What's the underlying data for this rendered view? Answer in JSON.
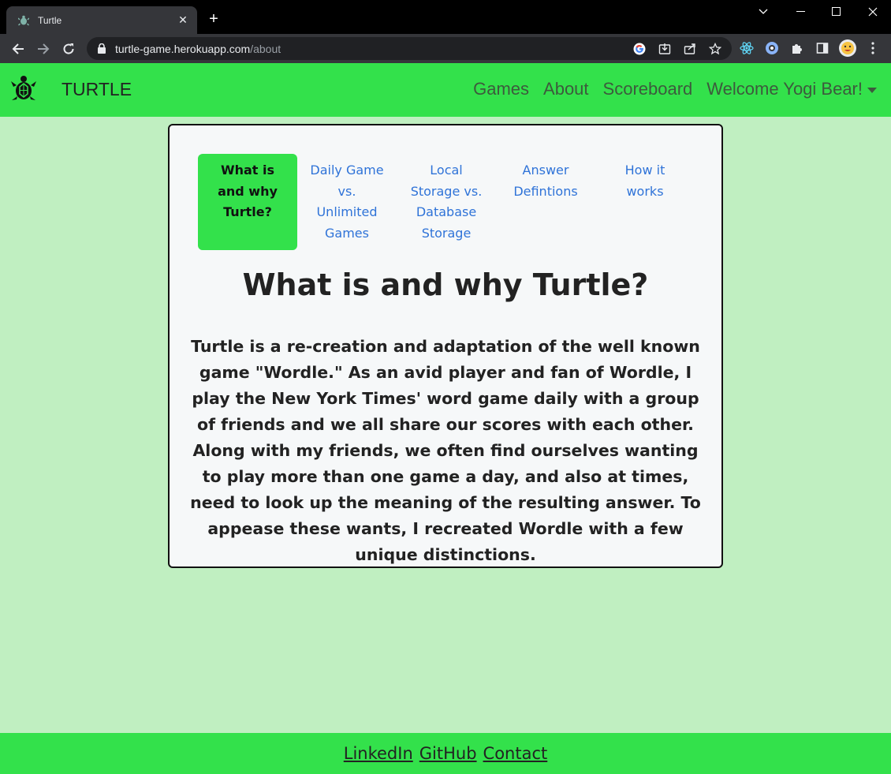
{
  "browser": {
    "tab_title": "Turtle",
    "tab_close": "✕",
    "new_tab": "+",
    "url_host": "turtle-game.herokuapp.com",
    "url_path": "/about"
  },
  "navbar": {
    "brand": "TURTLE",
    "links": [
      {
        "label": "Games"
      },
      {
        "label": "About"
      },
      {
        "label": "Scoreboard"
      }
    ],
    "user_menu": "Welcome Yogi Bear!"
  },
  "about": {
    "tabs": [
      {
        "label": "What is and why Turtle?",
        "lines": [
          "What is",
          "and why",
          "Turtle?"
        ],
        "active": true
      },
      {
        "label": "Daily Game vs. Unlimited Games",
        "lines": [
          "Daily Game",
          "vs.",
          "Unlimited",
          "Games"
        ],
        "active": false
      },
      {
        "label": "Local Storage vs. Database Storage",
        "lines": [
          "Local",
          "Storage vs.",
          "Database",
          "Storage"
        ],
        "active": false
      },
      {
        "label": "Answer Defintions",
        "lines": [
          "Answer",
          "Defintions"
        ],
        "active": false
      },
      {
        "label": "How it works",
        "lines": [
          "How it",
          "works"
        ],
        "active": false
      }
    ],
    "heading": "What is and why Turtle?",
    "paragraph": "Turtle is a re-creation and adaptation of the well known game \"Wordle.\" As an avid player and fan of Wordle, I play the New York Times' word game daily with a group of friends and we all share our scores with each other. Along with my friends, we often find ourselves wanting to play more than one game a day, and also at times, need to look up the meaning of the resulting answer. To appease these wants, I recreated Wordle with a few unique distinctions."
  },
  "footer": {
    "links": [
      {
        "label": "LinkedIn"
      },
      {
        "label": "GitHub"
      },
      {
        "label": "Contact"
      }
    ]
  },
  "colors": {
    "page_bg": "#c0efc1",
    "brand_green": "#33e14b",
    "link_blue": "#2f73d8",
    "card_bg": "#f6f8f9"
  }
}
